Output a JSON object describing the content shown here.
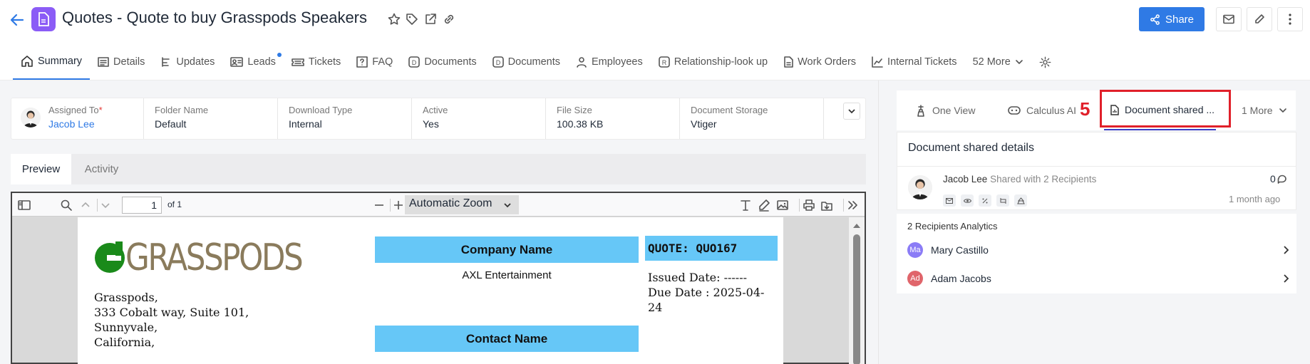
{
  "header": {
    "title": "Quotes - Quote to buy Grasspods Speakers",
    "share_label": "Share"
  },
  "tabs": [
    {
      "label": "Summary",
      "icon": "home-icon"
    },
    {
      "label": "Details",
      "icon": "list-icon"
    },
    {
      "label": "Updates",
      "icon": "timeline-icon"
    },
    {
      "label": "Leads",
      "icon": "contact-card-icon"
    },
    {
      "label": "Tickets",
      "icon": "ticket-icon"
    },
    {
      "label": "FAQ",
      "icon": "question-icon"
    },
    {
      "label": "Documents",
      "icon": "letter-d-icon"
    },
    {
      "label": "Documents",
      "icon": "letter-d-icon"
    },
    {
      "label": "Employees",
      "icon": "person-icon"
    },
    {
      "label": "Relationship-look up",
      "icon": "letter-r-icon"
    },
    {
      "label": "Work Orders",
      "icon": "document-icon"
    },
    {
      "label": "Internal Tickets",
      "icon": "chart-icon"
    }
  ],
  "tabs_more": "52 More",
  "fields": {
    "assigned_to_label": "Assigned To",
    "assigned_to_value": "Jacob Lee",
    "folder_label": "Folder Name",
    "folder_value": "Default",
    "download_label": "Download Type",
    "download_value": "Internal",
    "active_label": "Active",
    "active_value": "Yes",
    "size_label": "File Size",
    "size_value": "100.38 KB",
    "storage_label": "Document Storage",
    "storage_value": "Vtiger"
  },
  "preview_tabs": {
    "preview": "Preview",
    "activity": "Activity"
  },
  "viewer": {
    "page_number": "1",
    "page_of": "of 1",
    "zoom": "Automatic Zoom"
  },
  "document": {
    "logo_text": "GRASSPODS",
    "address_lines": [
      "Grasspods,",
      "333 Cobalt way, Suite 101,",
      "Sunnyvale,",
      "California,"
    ],
    "company_header": "Company Name",
    "company_value": "AXL Entertainment",
    "contact_header": "Contact Name",
    "quote_header": "QUOTE: QUO167",
    "issued_date": "Issued Date: ------",
    "due_date_line1": "Due Date : 2025-04-",
    "due_date_line2": "24"
  },
  "right_panel": {
    "tabs": {
      "one_view": "One View",
      "calculus": "Calculus AI",
      "doc_shared": "Document shared ...",
      "more": "1 More"
    },
    "step_marker": "5",
    "card_title": "Document shared details",
    "sharer_name": "Jacob Lee",
    "shared_with": "Shared with 2 Recipients",
    "comment_count": "0",
    "time_ago": "1 month ago",
    "analytics_title": "2 Recipients Analytics",
    "recipients": [
      {
        "initials": "Ma",
        "name": "Mary Castillo",
        "color": "#8b7cf6"
      },
      {
        "initials": "Ad",
        "name": "Adam Jacobs",
        "color": "#e0656b"
      }
    ]
  },
  "colors": {
    "primary": "#2f7ae5",
    "badge": "#8b5cf6",
    "highlight": "#e0202a",
    "table_header": "#66c7f7"
  }
}
